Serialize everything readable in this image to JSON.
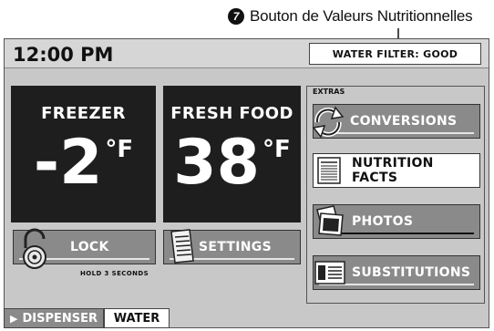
{
  "callout": {
    "number": "7",
    "text": "Bouton de Valeurs Nutritionnelles"
  },
  "header": {
    "time": "12:00 PM",
    "water_filter": "Water Filter: Good"
  },
  "freezer": {
    "label": "Freezer",
    "value": "-2",
    "unit": "°F"
  },
  "fresh_food": {
    "label": "Fresh Food",
    "value": "38",
    "unit": "°F"
  },
  "lock": {
    "label": "Lock",
    "hint": "HOLD 3 SECONDS"
  },
  "settings": {
    "label": "Settings"
  },
  "extras": {
    "title": "Extras",
    "items": [
      {
        "label": "Conversions",
        "icon": "conversions-arrows-icon"
      },
      {
        "label": "Nutrition Facts",
        "icon": "nutrition-label-icon"
      },
      {
        "label": "Photos",
        "icon": "photos-icon"
      },
      {
        "label": "Substitutions",
        "icon": "substitutions-card-icon"
      }
    ]
  },
  "dispenser": {
    "label": "Dispenser",
    "mode": "Water"
  },
  "colors": {
    "panel": "#c8c8c8",
    "temp_box": "#1e1e1e",
    "button": "#8a8a8a",
    "selected": "#ffffff"
  }
}
